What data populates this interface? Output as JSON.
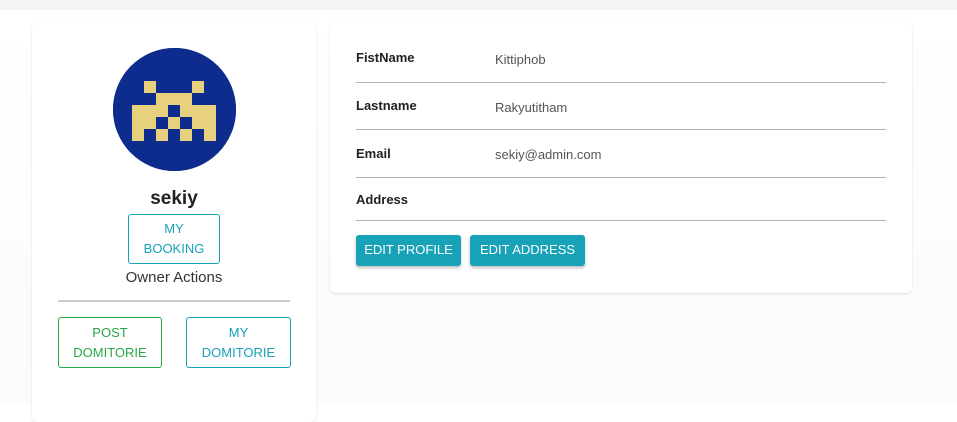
{
  "profile": {
    "username": "sekiy",
    "my_booking_label": "MY BOOKING",
    "owner_actions_label": "Owner Actions",
    "post_domitorie_label": "POST DOMITORIE",
    "my_domitorie_label": "MY DOMITORIE",
    "avatar_icon": "identicon-avatar",
    "avatar_colors": {
      "background": "#0e2b8e",
      "pattern": "#e8d17e"
    }
  },
  "details": {
    "fields": [
      {
        "label": "FistName",
        "value": "Kittiphob"
      },
      {
        "label": "Lastname",
        "value": "Rakyutitham"
      },
      {
        "label": "Email",
        "value": "sekiy@admin.com"
      },
      {
        "label": "Address",
        "value": ""
      }
    ],
    "edit_profile_label": "EDIT PROFILE",
    "edit_address_label": "EDIT ADDRESS"
  },
  "colors": {
    "accent": "#17a2b8",
    "success": "#28a745"
  }
}
